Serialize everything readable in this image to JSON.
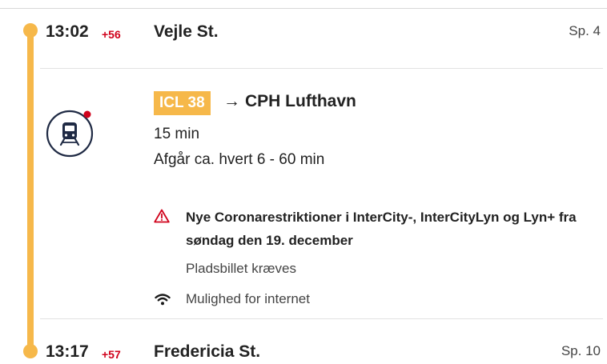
{
  "departure": {
    "time": "13:02",
    "delay": "+56",
    "station": "Vejle St.",
    "track": "Sp. 4"
  },
  "journey": {
    "mode_icon": "train-icon",
    "line": "ICL 38",
    "arrow": "→",
    "destination": "CPH Lufthavn",
    "duration": "15 min",
    "frequency": "Afgår ca. hvert 6 - 60 min",
    "notice": {
      "icon": "warning-triangle-icon",
      "text": "Nye Coronarestriktioner i InterCity-, InterCityLyn og Lyn+ fra søndag den 19. december"
    },
    "seat_info": "Pladsbillet kræves",
    "amenity": {
      "icon": "wifi-icon",
      "text": "Mulighed for internet"
    }
  },
  "arrival": {
    "time": "13:17",
    "delay": "+57",
    "station": "Fredericia St.",
    "track": "Sp. 10"
  },
  "colors": {
    "accent": "#f6b84a",
    "delay": "#d0021b",
    "alert_dot": "#d0021b",
    "icon": "#1f2a44"
  }
}
